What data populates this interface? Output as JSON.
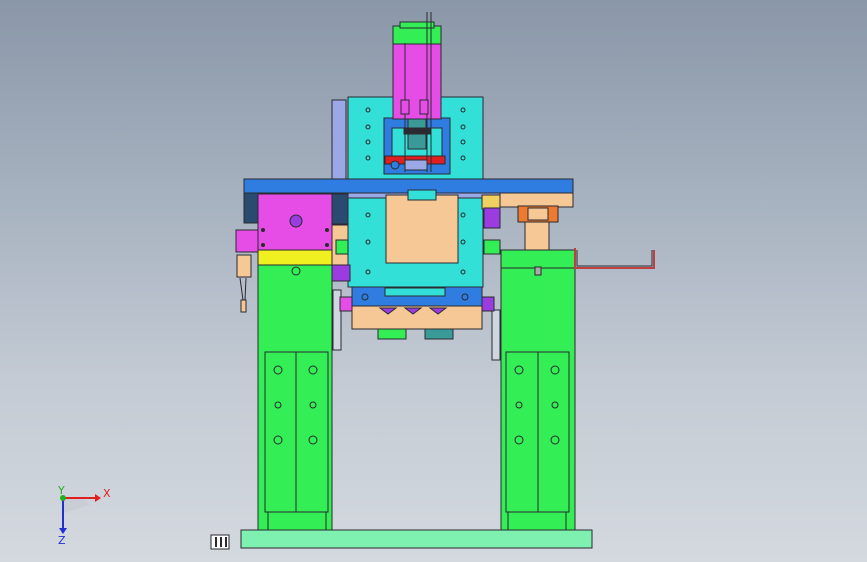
{
  "viewport": {
    "background_top": "#8a97a8",
    "background_bottom": "#d4d9df"
  },
  "triad": {
    "x_label": "X",
    "y_label": "Y",
    "z_label": "Z",
    "x_color": "#e02020",
    "y_color": "#20b020",
    "z_color": "#2030d0"
  },
  "colors": {
    "green": "#33ee55",
    "cyan": "#33e0d8",
    "blue": "#2f7de0",
    "magenta": "#e64de6",
    "purple": "#9b3ce0",
    "peach": "#f5c896",
    "yellow": "#f0f020",
    "lavender": "#9ba8e6",
    "base": "#7ef0b0",
    "orange": "#ee7a30",
    "teal": "#3a9a98",
    "dark": "#2a2a30"
  },
  "icons": {
    "triad": "coordinate-triad-icon",
    "view_cube": "view-orientation-icon"
  }
}
